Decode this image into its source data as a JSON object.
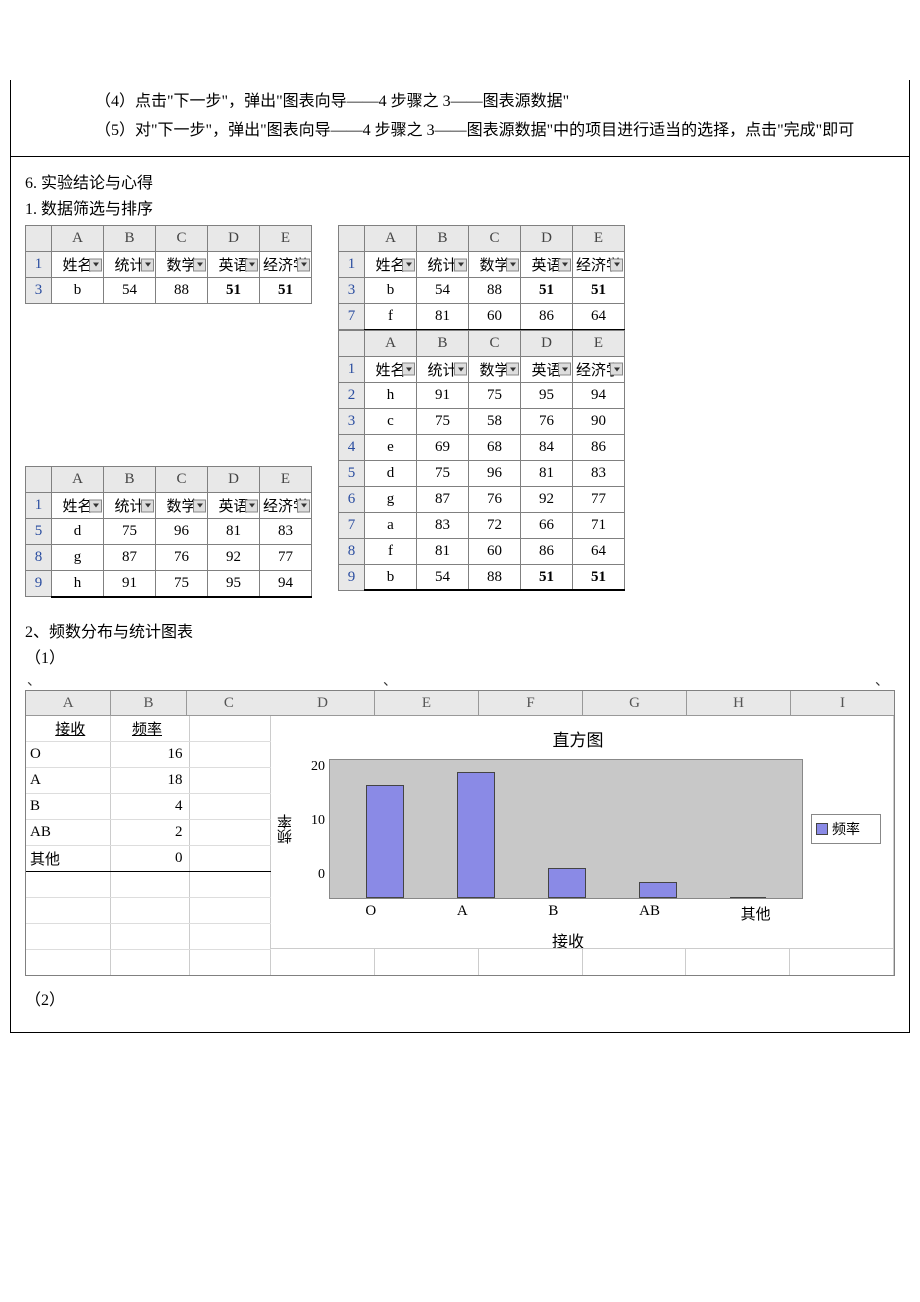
{
  "doc": {
    "step4": "（4）点击\"下一步\"，弹出\"图表向导——4 步骤之 3——图表源数据\"",
    "step5": "（5）对\"下一步\"，弹出\"图表向导——4 步骤之 3——图表源数据\"中的项目进行适当的选择，点击\"完成\"即可",
    "heading6": "6. 实验结论与心得",
    "heading1": "1. 数据筛选与排序",
    "heading2": "2、频数分布与统计图表",
    "sub1": "（1）",
    "sub2": "（2）"
  },
  "cols": {
    "A": "A",
    "B": "B",
    "C": "C",
    "D": "D",
    "E": "E",
    "F": "F",
    "G": "G",
    "H": "H",
    "I": "I"
  },
  "headers": {
    "name": "姓名",
    "stat": "统计",
    "math": "数学",
    "eng": "英语",
    "econ": "经济学"
  },
  "rowlabels": {
    "r1": "1",
    "r2": "2",
    "r3": "3",
    "r4": "4",
    "r5": "5",
    "r6": "6",
    "r7": "7",
    "r8": "8",
    "r9": "9"
  },
  "tableA": {
    "r3": {
      "name": "b",
      "stat": "54",
      "math": "88",
      "eng": "51",
      "econ": "51"
    }
  },
  "tableB": {
    "r3": {
      "name": "b",
      "stat": "54",
      "math": "88",
      "eng": "51",
      "econ": "51"
    },
    "r7": {
      "name": "f",
      "stat": "81",
      "math": "60",
      "eng": "86",
      "econ": "64"
    }
  },
  "tableC": {
    "r5": {
      "name": "d",
      "stat": "75",
      "math": "96",
      "eng": "81",
      "econ": "83"
    },
    "r8": {
      "name": "g",
      "stat": "87",
      "math": "76",
      "eng": "92",
      "econ": "77"
    },
    "r9": {
      "name": "h",
      "stat": "91",
      "math": "75",
      "eng": "95",
      "econ": "94"
    }
  },
  "tableD": {
    "r2": {
      "name": "h",
      "stat": "91",
      "math": "75",
      "eng": "95",
      "econ": "94"
    },
    "r3": {
      "name": "c",
      "stat": "75",
      "math": "58",
      "eng": "76",
      "econ": "90"
    },
    "r4": {
      "name": "e",
      "stat": "69",
      "math": "68",
      "eng": "84",
      "econ": "86"
    },
    "r5": {
      "name": "d",
      "stat": "75",
      "math": "96",
      "eng": "81",
      "econ": "83"
    },
    "r6": {
      "name": "g",
      "stat": "87",
      "math": "76",
      "eng": "92",
      "econ": "77"
    },
    "r7": {
      "name": "a",
      "stat": "83",
      "math": "72",
      "eng": "66",
      "econ": "71"
    },
    "r8": {
      "name": "f",
      "stat": "81",
      "math": "60",
      "eng": "86",
      "econ": "64"
    },
    "r9": {
      "name": "b",
      "stat": "54",
      "math": "88",
      "eng": "51",
      "econ": "51"
    }
  },
  "freq": {
    "h0": "接收",
    "h1": "频率",
    "rows": {
      "O": {
        "label": "O",
        "val": "16"
      },
      "A": {
        "label": "A",
        "val": "18"
      },
      "B": {
        "label": "B",
        "val": "4"
      },
      "AB": {
        "label": "AB",
        "val": "2"
      },
      "Oth": {
        "label": "其他",
        "val": "0"
      }
    }
  },
  "chart_data": {
    "type": "bar",
    "title": "直方图",
    "xlabel": "接收",
    "ylabel": "频率",
    "legend": "频率",
    "categories": [
      "O",
      "A",
      "B",
      "AB",
      "其他"
    ],
    "values": [
      16,
      18,
      4,
      2,
      0
    ],
    "yticks": [
      "0",
      "10",
      "20"
    ],
    "ylim": [
      0,
      20
    ]
  },
  "backtick": "、"
}
